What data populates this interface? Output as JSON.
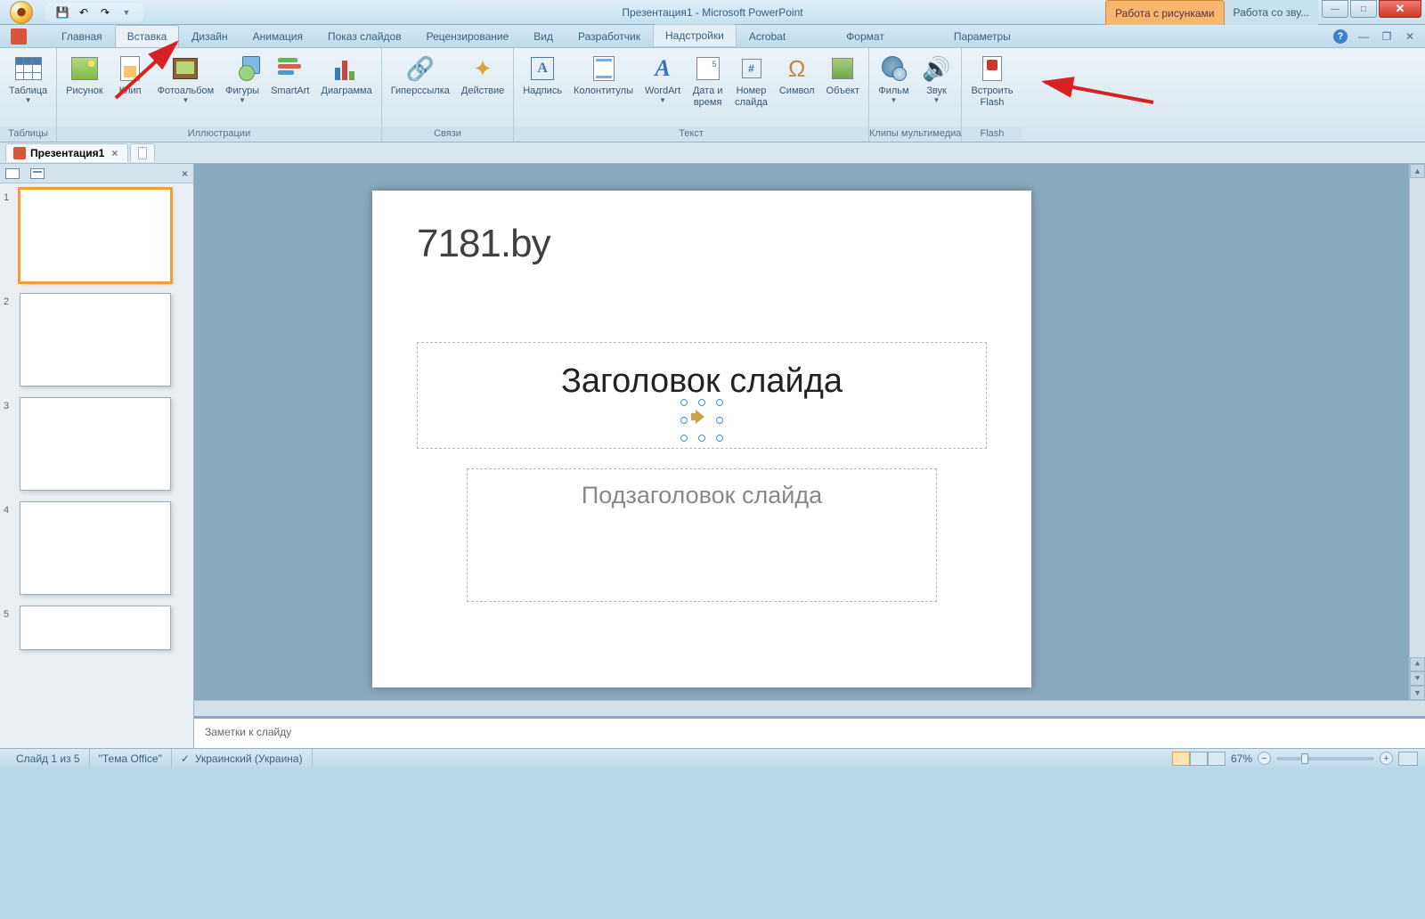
{
  "title": "Презентация1 - Microsoft PowerPoint",
  "context_tabs": {
    "pictures": "Работа с рисунками",
    "sound": "Работа со зву..."
  },
  "tabs": {
    "home": "Главная",
    "insert": "Вставка",
    "design": "Дизайн",
    "animation": "Анимация",
    "slideshow": "Показ слайдов",
    "review": "Рецензирование",
    "view": "Вид",
    "developer": "Разработчик",
    "addins": "Надстройки",
    "acrobat": "Acrobat",
    "format": "Формат",
    "parameters": "Параметры"
  },
  "ribbon": {
    "tables": {
      "label": "Таблицы",
      "table": "Таблица"
    },
    "illustrations": {
      "label": "Иллюстрации",
      "picture": "Рисунок",
      "clip": "Клип",
      "album": "Фотоальбом",
      "shapes": "Фигуры",
      "smartart": "SmartArt",
      "chart": "Диаграмма"
    },
    "links": {
      "label": "Связи",
      "hyperlink": "Гиперссылка",
      "action": "Действие"
    },
    "text": {
      "label": "Текст",
      "textbox": "Надпись",
      "headerfooter": "Колонтитулы",
      "wordart": "WordArt",
      "datetime": "Дата и\nвремя",
      "slidenum": "Номер\nслайда",
      "symbol": "Символ",
      "object": "Объект"
    },
    "media": {
      "label": "Клипы мультимедиа",
      "movie": "Фильм",
      "sound": "Звук"
    },
    "flash": {
      "label": "Flash",
      "embed": "Встроить\nFlash"
    }
  },
  "doc_tab": "Презентация1",
  "thumbs": [
    "1",
    "2",
    "3",
    "4",
    "5"
  ],
  "slide": {
    "watermark": "7181.by",
    "title_placeholder": "Заголовок слайда",
    "subtitle_placeholder": "Подзаголовок слайда"
  },
  "notes_placeholder": "Заметки к слайду",
  "status": {
    "slide_info": "Слайд 1 из 5",
    "theme": "\"Тема Office\"",
    "language": "Украинский (Украина)",
    "zoom": "67%"
  }
}
